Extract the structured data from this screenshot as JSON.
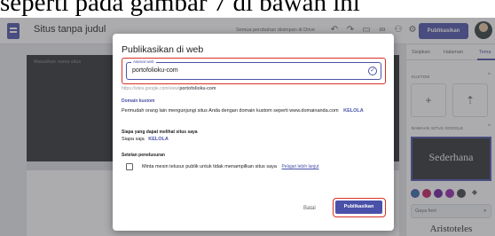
{
  "caption": "seperti pada gambar 7 di bawah ini",
  "topbar": {
    "title": "Situs tanpa judul",
    "save_note": "Semua perubahan disimpan di Drive",
    "publish_label": "Publikasikan"
  },
  "canvas": {
    "site_name": "Masukkan nama situs"
  },
  "panel": {
    "tabs": [
      "Sisipkan",
      "Halaman",
      "Tema"
    ],
    "custom_label": "KUSTOM",
    "themes_label": "BAWAAN SITUS GOOGLE",
    "theme_name": "Sederhana",
    "font_placeholder": "Gaya font",
    "theme2_name": "Aristoteles"
  },
  "dialog": {
    "title": "Publikasikan di web",
    "url_label": "Alamat web",
    "url_value": "portofolioku-com",
    "url_full_prefix": "https://sites.google.com/view/",
    "url_full_suffix": "portofolioku-com",
    "custom_domain_title": "Domain kustom",
    "custom_domain_text": "Permudah orang lain mengunjungi situs Anda dengan domain kustom seperti www.domainanda.com",
    "manage_label": "KELOLA",
    "who_title": "Siapa yang dapat melihat situs saya",
    "who_value": "Siapa saja",
    "search_title": "Setelan penelusuran",
    "search_text": "Minta mesin telusur publik untuk tidak menampilkan situs saya",
    "learn_more": "Pelajari lebih lanjut",
    "cancel_label": "Batal",
    "publish_label": "Publikasikan"
  },
  "colors": {
    "accent": "#4a51a8",
    "highlight": "#d93025"
  }
}
